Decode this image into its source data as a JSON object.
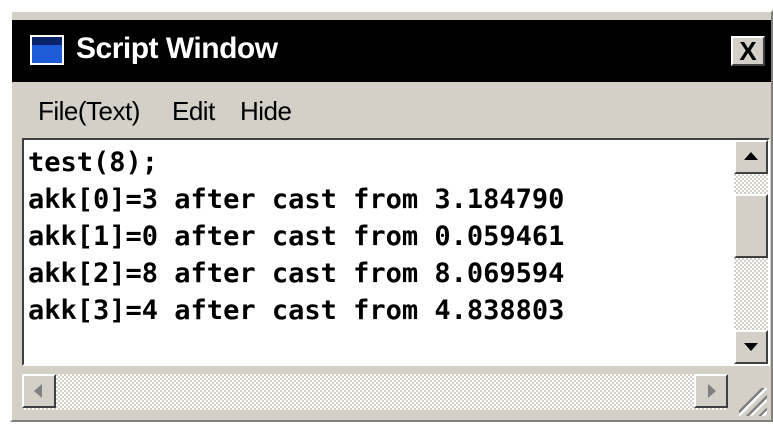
{
  "window": {
    "title": "Script Window",
    "close_label": "X"
  },
  "menu": {
    "items": [
      "File(Text)",
      "Edit",
      "Hide"
    ]
  },
  "editor": {
    "lines": [
      "test(8);",
      "akk[0]=3 after cast from 3.184790",
      "akk[1]=0 after cast from 0.059461",
      "akk[2]=8 after cast from 8.069594",
      "akk[3]=4 after cast from 4.838803"
    ]
  }
}
